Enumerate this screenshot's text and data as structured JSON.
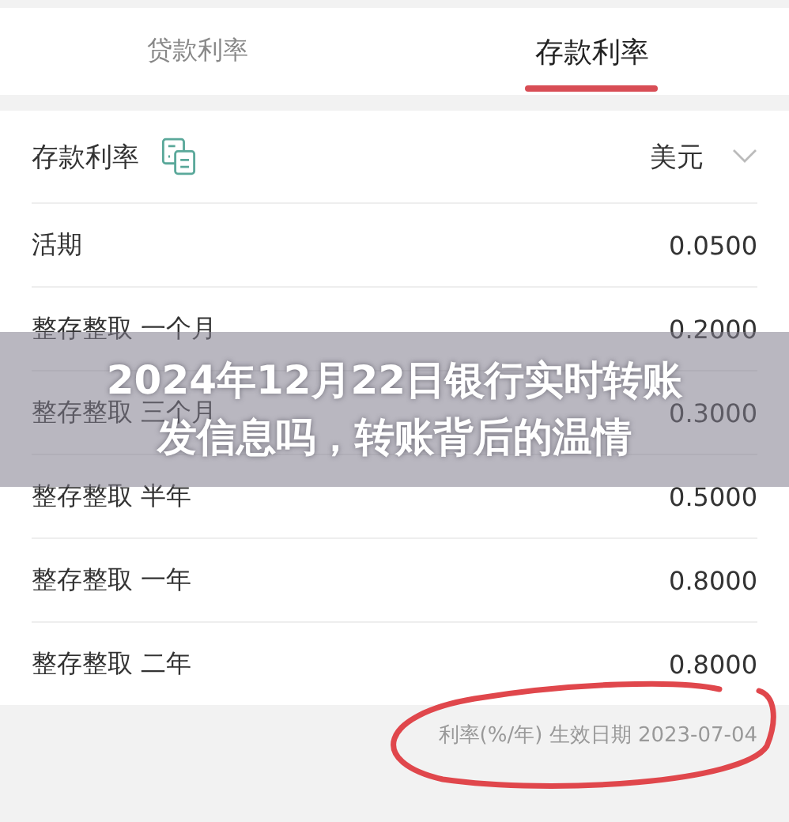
{
  "tabs": [
    {
      "label": "贷款利率",
      "selected": false
    },
    {
      "label": "存款利率",
      "selected": true
    }
  ],
  "header": {
    "title": "存款利率",
    "currency": "美元"
  },
  "rows": [
    {
      "term": "活期",
      "rate": "0.0500"
    },
    {
      "term": "整存整取 一个月",
      "rate": "0.2000"
    },
    {
      "term": "整存整取 三个月",
      "rate": "0.3000"
    },
    {
      "term": "整存整取 半年",
      "rate": "0.5000"
    },
    {
      "term": "整存整取 一年",
      "rate": "0.8000"
    },
    {
      "term": "整存整取 二年",
      "rate": "0.8000"
    }
  ],
  "footnote": "利率(%/年) 生效日期 2023-07-04",
  "banner": {
    "title": "2024年12月22日银行实时转账发信息吗，转账背后的温情"
  }
}
